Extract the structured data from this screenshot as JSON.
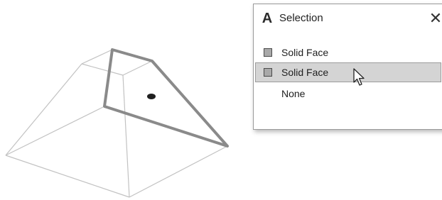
{
  "dialog": {
    "title": "Selection",
    "app_icon_glyph": "A",
    "close_glyph": "✕",
    "options": [
      {
        "label": "Solid Face",
        "swatch": true,
        "highlighted": false
      },
      {
        "label": "Solid Face",
        "swatch": true,
        "highlighted": true
      },
      {
        "label": "None",
        "swatch": false,
        "highlighted": false
      }
    ]
  },
  "icons": {
    "app": "autocad-a-icon",
    "close": "close-icon",
    "cursor": "mouse-pointer-icon"
  },
  "colors": {
    "highlight": "#d4d4d4",
    "face_edge": "#8a8a8a",
    "wireframe": "#c2c2c2"
  }
}
